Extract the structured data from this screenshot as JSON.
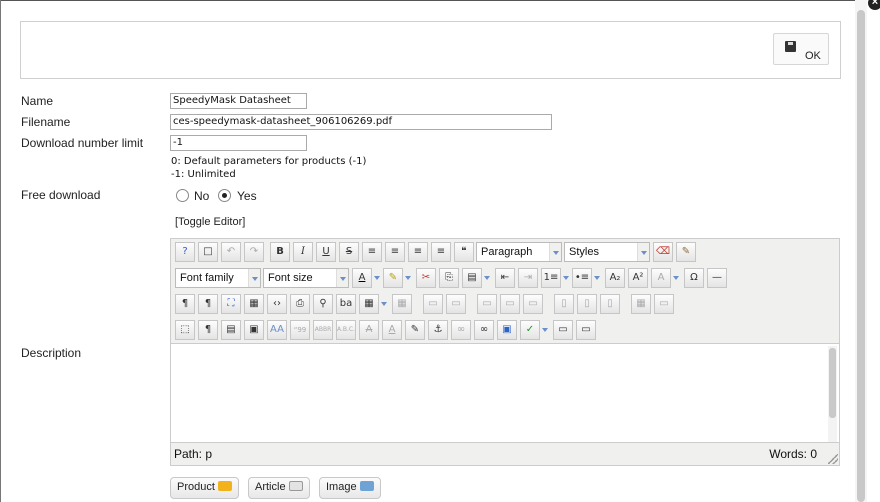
{
  "toolbar": {
    "ok_label": "OK"
  },
  "fields": {
    "name": {
      "label": "Name",
      "value": "SpeedyMask Datasheet"
    },
    "filename": {
      "label": "Filename",
      "value": "ces-speedymask-datasheet_906106269.pdf"
    },
    "download_limit": {
      "label": "Download number limit",
      "value": "-1",
      "hint_1": "0: Default parameters for products (-1)",
      "hint_2": "-1: Unlimited"
    },
    "free_download": {
      "label": "Free download",
      "option_no": "No",
      "option_yes": "Yes",
      "selected": "Yes"
    },
    "description": {
      "label": "Description"
    }
  },
  "editor": {
    "toggle_label": "[Toggle Editor]",
    "format_select": "Paragraph",
    "styles_select": "Styles",
    "font_family_select": "Font family",
    "font_size_select": "Font size",
    "status_path": "Path:  p",
    "status_words": "Words: 0"
  },
  "insert_buttons": {
    "product": "Product",
    "article": "Article",
    "image": "Image"
  },
  "colors": {
    "accent_blue": "#6a8fc9",
    "border": "#cccccc",
    "editor_bg": "#f0f0ee"
  }
}
